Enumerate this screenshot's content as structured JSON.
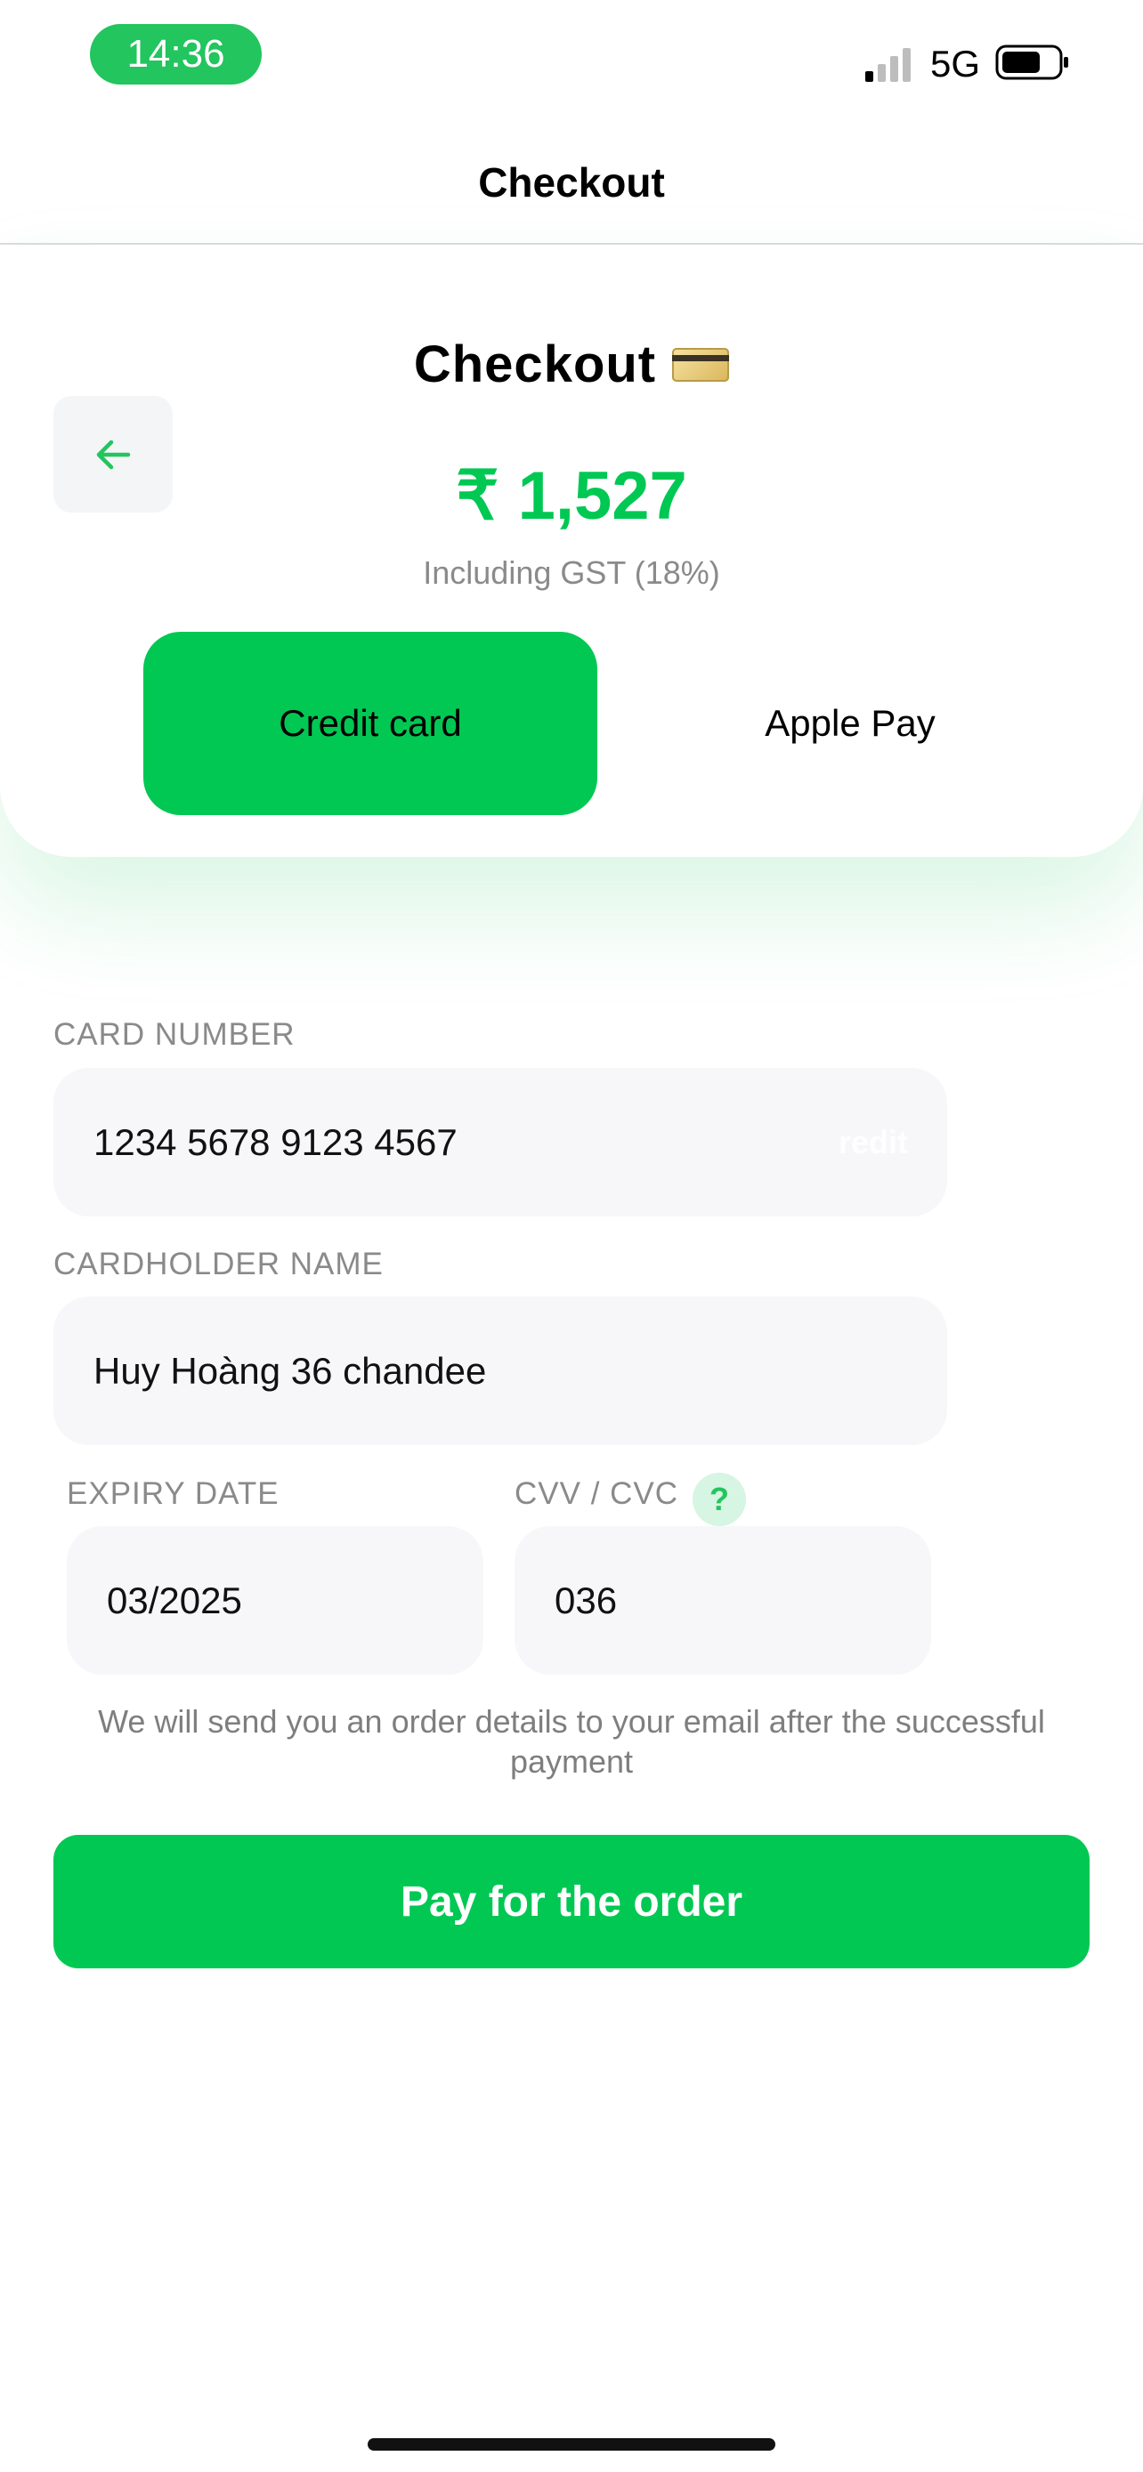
{
  "status_bar": {
    "time": "14:36",
    "network": "5G"
  },
  "nav": {
    "title": "Checkout"
  },
  "summary": {
    "title": "Checkout",
    "amount": "₹ 1,527",
    "tax_note": "Including GST (18%)",
    "tabs": [
      {
        "label": "Credit card",
        "selected": true
      },
      {
        "label": "Apple Pay",
        "selected": false
      }
    ]
  },
  "form": {
    "card_number": {
      "label": "CARD NUMBER",
      "value": "1234 5678 9123 4567",
      "brand_text": "redit"
    },
    "cardholder": {
      "label": "CARDHOLDER NAME",
      "value": "Huy Hoàng 36 chandee"
    },
    "expiry": {
      "label": "EXPIRY DATE",
      "value": "03/2025"
    },
    "cvv": {
      "label": "CVV / CVC",
      "value": "036",
      "help": "?"
    }
  },
  "notice": "We will send you an order details to your email after the successful payment",
  "pay_button": {
    "label": "Pay for the order"
  },
  "colors": {
    "accent": "#00c853",
    "field_bg": "#f7f7f9",
    "muted_text": "#8a8a8a"
  }
}
